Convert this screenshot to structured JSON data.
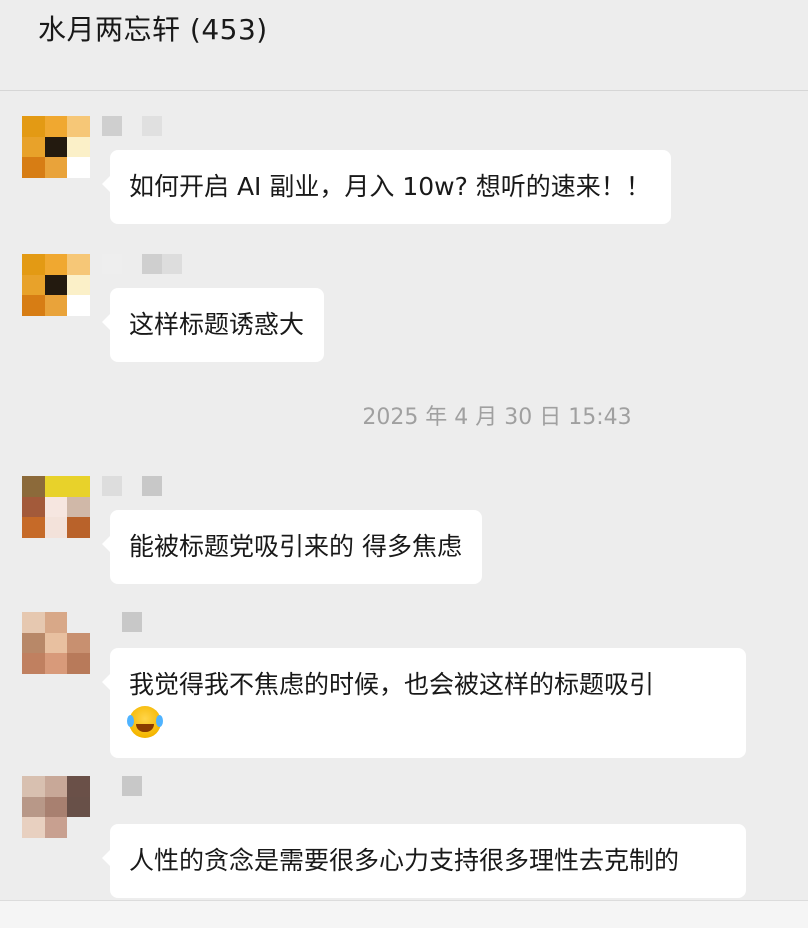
{
  "header": {
    "title": "水月两忘轩 (453)"
  },
  "timestamp": "2025 年 4 月 30 日 15:43",
  "messages": [
    {
      "text": "如何开启 AI 副业，月入 10w? 想听的速来！！"
    },
    {
      "text": "这样标题诱惑大"
    },
    {
      "text": "能被标题党吸引来的 得多焦虑"
    },
    {
      "text": "我觉得我不焦虑的时候，也会被这样的标题吸引",
      "emoji": "crying-laughing-emoji"
    },
    {
      "text": "人性的贪念是需要很多心力支持很多理性去克制的"
    }
  ],
  "colors": {
    "background": "#ededed",
    "bubble": "#ffffff",
    "timestamp": "#a0a0a0"
  }
}
